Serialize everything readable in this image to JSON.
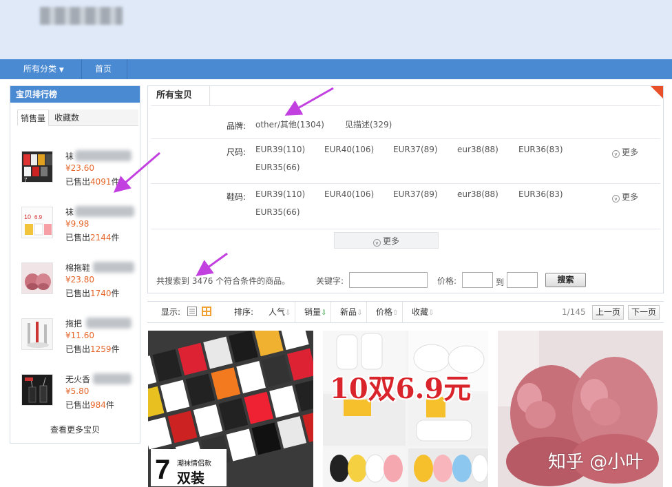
{
  "nav": {
    "all_categories": "所有分类",
    "home": "首页"
  },
  "ranking": {
    "title": "宝贝排行榜",
    "tabs": [
      "销售量",
      "收藏数"
    ],
    "items": [
      {
        "name": "袜",
        "price": "¥23.60",
        "sold_prefix": "已售出",
        "sold_num": "4091",
        "sold_suffix": "件"
      },
      {
        "name": "袜",
        "price": "¥9.98",
        "sold_prefix": "已售出",
        "sold_num": "2144",
        "sold_suffix": "件"
      },
      {
        "name": "棉拖鞋",
        "price": "¥23.80",
        "sold_prefix": "已售出",
        "sold_num": "1740",
        "sold_suffix": "件"
      },
      {
        "name": "拖把",
        "price": "¥11.60",
        "sold_prefix": "已售出",
        "sold_num": "1259",
        "sold_suffix": "件"
      },
      {
        "name": "无火香",
        "price": "¥5.80",
        "sold_prefix": "已售出",
        "sold_num": "984",
        "sold_suffix": "件"
      }
    ],
    "more": "查看更多宝贝"
  },
  "main": {
    "title": "所有宝贝",
    "brand_label": "品牌:",
    "brand_values": [
      "other/其他(1304)",
      "见描述(329)"
    ],
    "size_label": "尺码:",
    "size_values": [
      "EUR39(110)",
      "EUR40(106)",
      "EUR37(89)",
      "eur38(88)",
      "EUR36(83)",
      "EUR35(66)"
    ],
    "shoe_label": "鞋码:",
    "shoe_values": [
      "EUR39(110)",
      "EUR40(106)",
      "EUR37(89)",
      "eur38(88)",
      "EUR36(83)",
      "EUR35(66)"
    ],
    "more": "更多",
    "expand": "更多",
    "search_count": "共搜索到 3476 个符合条件的商品。",
    "keyword_label": "关键字:",
    "price_label": "价格:",
    "to_label": "到",
    "search_button": "搜索"
  },
  "sortbar": {
    "display_label": "显示:",
    "sort_label": "排序:",
    "options": [
      "人气",
      "销量",
      "新品",
      "价格",
      "收藏"
    ],
    "active_option": "销量",
    "page_info": "1/145",
    "prev": "上一页",
    "next": "下一页"
  },
  "products": {
    "p1_badge": "7",
    "p1_badge_top": "潮袜情侣款",
    "p1_badge_bottom": "双装",
    "p2_promo": "10双6.9元"
  },
  "watermark": "知乎 @小叶",
  "colors": {
    "nav": "#4a8ad3",
    "header_bg": "#dfe9f8",
    "price": "#e5662a",
    "arrow": "#c23fe0"
  }
}
